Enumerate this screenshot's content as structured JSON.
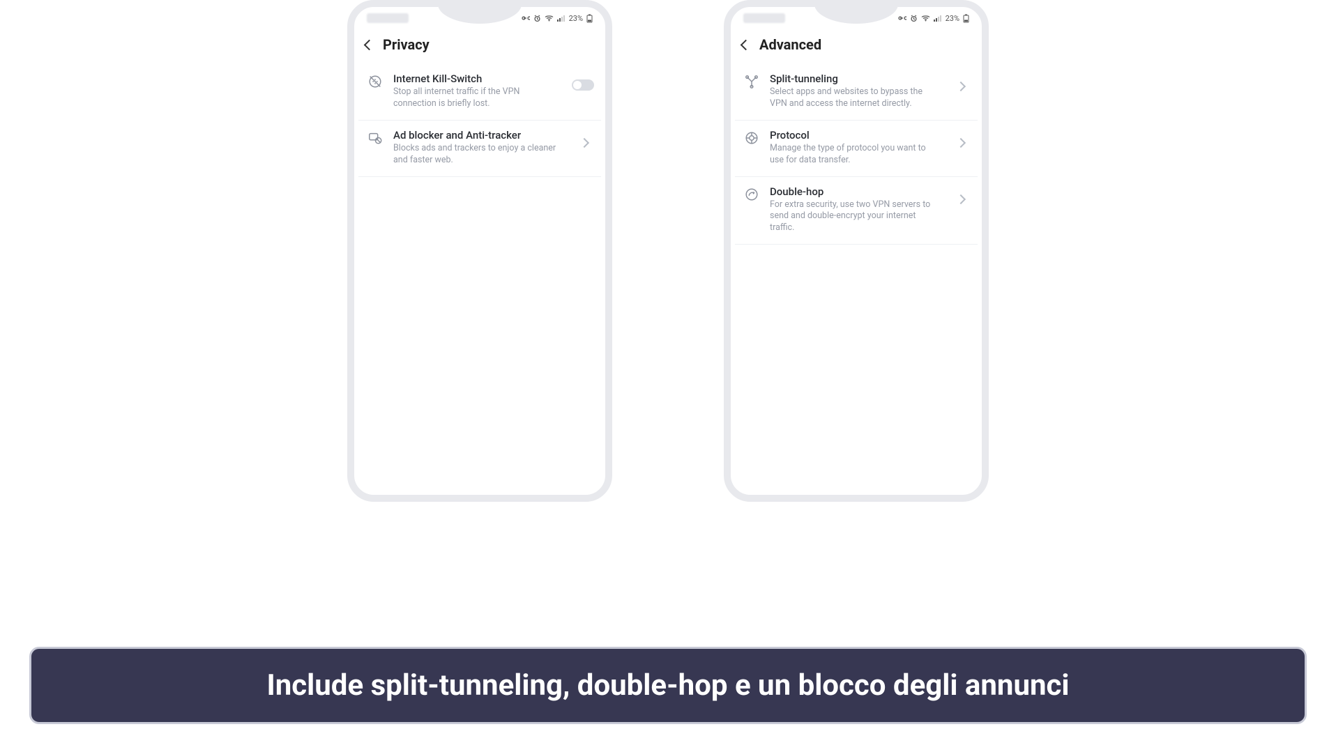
{
  "status": {
    "battery_text": "23%"
  },
  "phone1": {
    "title": "Privacy",
    "rows": [
      {
        "title": "Internet Kill-Switch",
        "desc": "Stop all internet traffic if the VPN connection is briefly lost."
      },
      {
        "title": "Ad blocker and Anti-tracker",
        "desc": "Blocks ads and trackers to enjoy a cleaner and faster web."
      }
    ]
  },
  "phone2": {
    "title": "Advanced",
    "rows": [
      {
        "title": "Split-tunneling",
        "desc": "Select apps and websites to bypass the VPN and access the internet directly."
      },
      {
        "title": "Protocol",
        "desc": "Manage the type of protocol you want to use for data transfer."
      },
      {
        "title": "Double-hop",
        "desc": "For extra security, use two VPN servers to send and double-encrypt your internet traffic."
      }
    ]
  },
  "banner_text": "Include split-tunneling, double-hop e un blocco degli annunci"
}
